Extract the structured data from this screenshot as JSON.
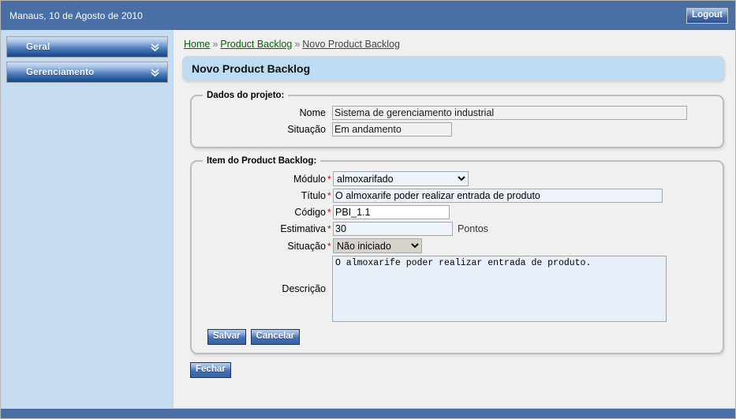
{
  "header": {
    "date_text": "Manaus, 10 de Agosto de 2010",
    "logout_label": "Logout",
    "bg_color": "#4a6fa5"
  },
  "sidebar": {
    "bg_color": "#c6dcf0",
    "items": [
      {
        "label": "Geral",
        "icon": "chevron-double-down-icon"
      },
      {
        "label": "Gerenciamento",
        "icon": "chevron-double-down-icon"
      }
    ]
  },
  "breadcrumb": {
    "items": [
      {
        "label": "Home",
        "current": false
      },
      {
        "label": "Product Backlog",
        "current": false
      },
      {
        "label": "Novo Product Backlog",
        "current": true
      }
    ],
    "separator": "»",
    "link_color": "#006600"
  },
  "page_title": "Novo Product Backlog",
  "project_fieldset": {
    "legend": "Dados do projeto:",
    "fields": [
      {
        "label": "Nome",
        "value": "Sistema de gerenciamento industrial",
        "required": false
      },
      {
        "label": "Situação",
        "value": "Em andamento",
        "required": false
      }
    ]
  },
  "item_fieldset": {
    "legend": "Item do Product Backlog:",
    "modulo": {
      "label": "Módulo",
      "required_mark": "*",
      "value": "almoxarifado",
      "options": [
        "almoxarifado"
      ]
    },
    "titulo": {
      "label": "Título",
      "required_mark": "*",
      "value": "O almoxarife poder realizar entrada de produto",
      "placeholder": ""
    },
    "codigo": {
      "label": "Código",
      "required_mark": "*",
      "value": "PBI_1.1",
      "placeholder": ""
    },
    "estimativa": {
      "label": "Estimativa",
      "required_mark": "*",
      "value": "30",
      "suffix": "Pontos",
      "placeholder": ""
    },
    "situacao": {
      "label": "Situação",
      "required_mark": "*",
      "value": "Não iniciado",
      "options": [
        "Não iniciado"
      ]
    },
    "descricao": {
      "label": "Descrição",
      "required_mark": "",
      "value": "O almoxarife poder realizar entrada de produto.",
      "placeholder": ""
    },
    "save_label": "Salvar",
    "cancel_label": "Cancelar"
  },
  "close_label": "Fechar",
  "footer": {
    "bg_color": "#4a6fa5"
  }
}
